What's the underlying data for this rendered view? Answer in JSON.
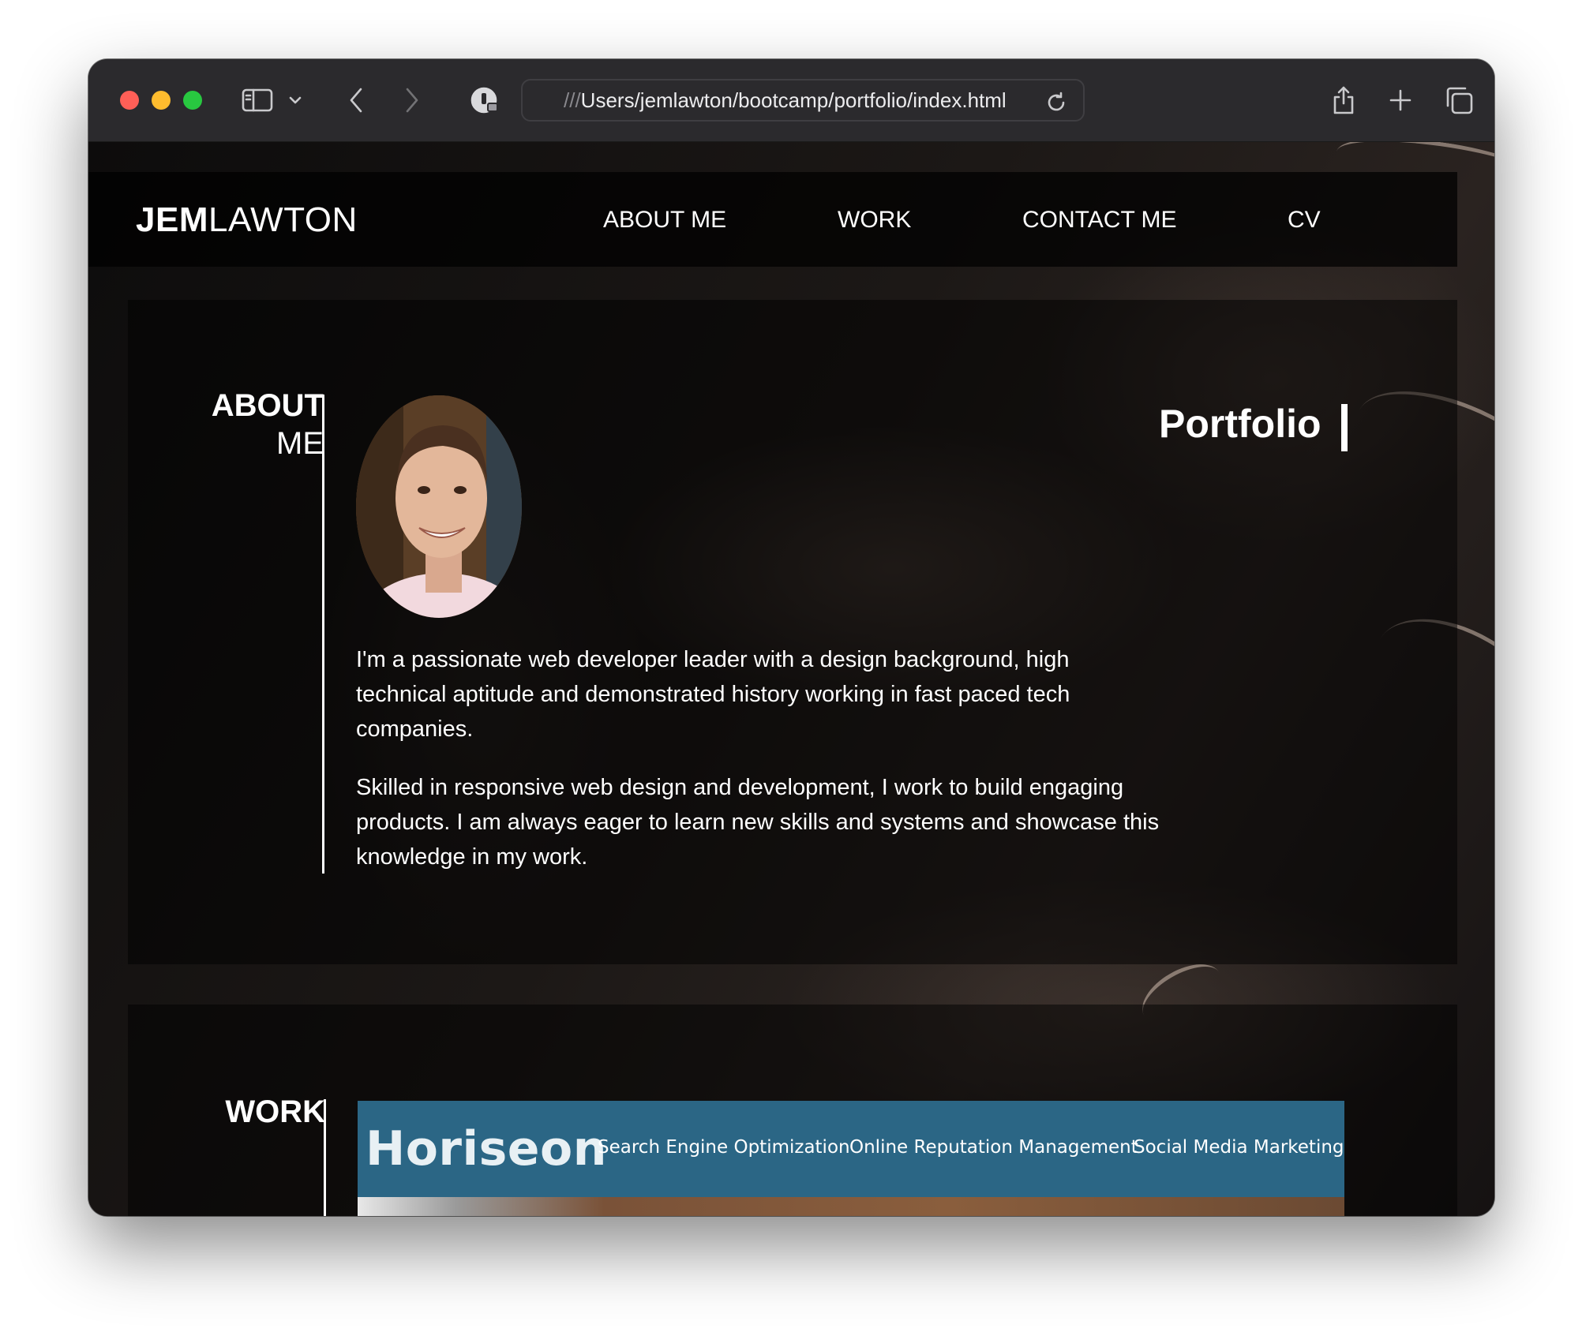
{
  "browser": {
    "address_prefix": "///",
    "address_path": "Users/jemlawton/bootcamp/portfolio/index.html",
    "icons": [
      "sidebar-icon",
      "chevron-down-icon",
      "back-icon",
      "forward-icon",
      "password-icon",
      "reload-icon",
      "share-icon",
      "new-tab-icon",
      "tabs-overview-icon"
    ]
  },
  "nav": {
    "brand_bold": "JEM",
    "brand_light": "LAWTON",
    "links": [
      {
        "label": "ABOUT ME"
      },
      {
        "label": "WORK"
      },
      {
        "label": "CONTACT ME"
      },
      {
        "label": "CV"
      }
    ]
  },
  "about": {
    "heading_line1": "ABOUT",
    "heading_line2": "ME",
    "portfolio_title": "Portfolio",
    "paragraph1": "I'm a passionate web developer leader with a design background, high technical aptitude and demonstrated history working in fast paced tech companies.",
    "paragraph2": "Skilled in responsive web design and development, I work to build engaging products. I am always eager to learn new skills and systems and showcase this knowledge in my work."
  },
  "work": {
    "heading": "WORK",
    "project": {
      "brand": "Horiseon",
      "links": [
        "Search Engine Optimization",
        "Online Reputation Management",
        "Social Media Marketing"
      ]
    }
  },
  "colors": {
    "horiseon_header": "#2b6685",
    "traffic_red": "#ff5f57",
    "traffic_yellow": "#febc2e",
    "traffic_green": "#28c840"
  }
}
